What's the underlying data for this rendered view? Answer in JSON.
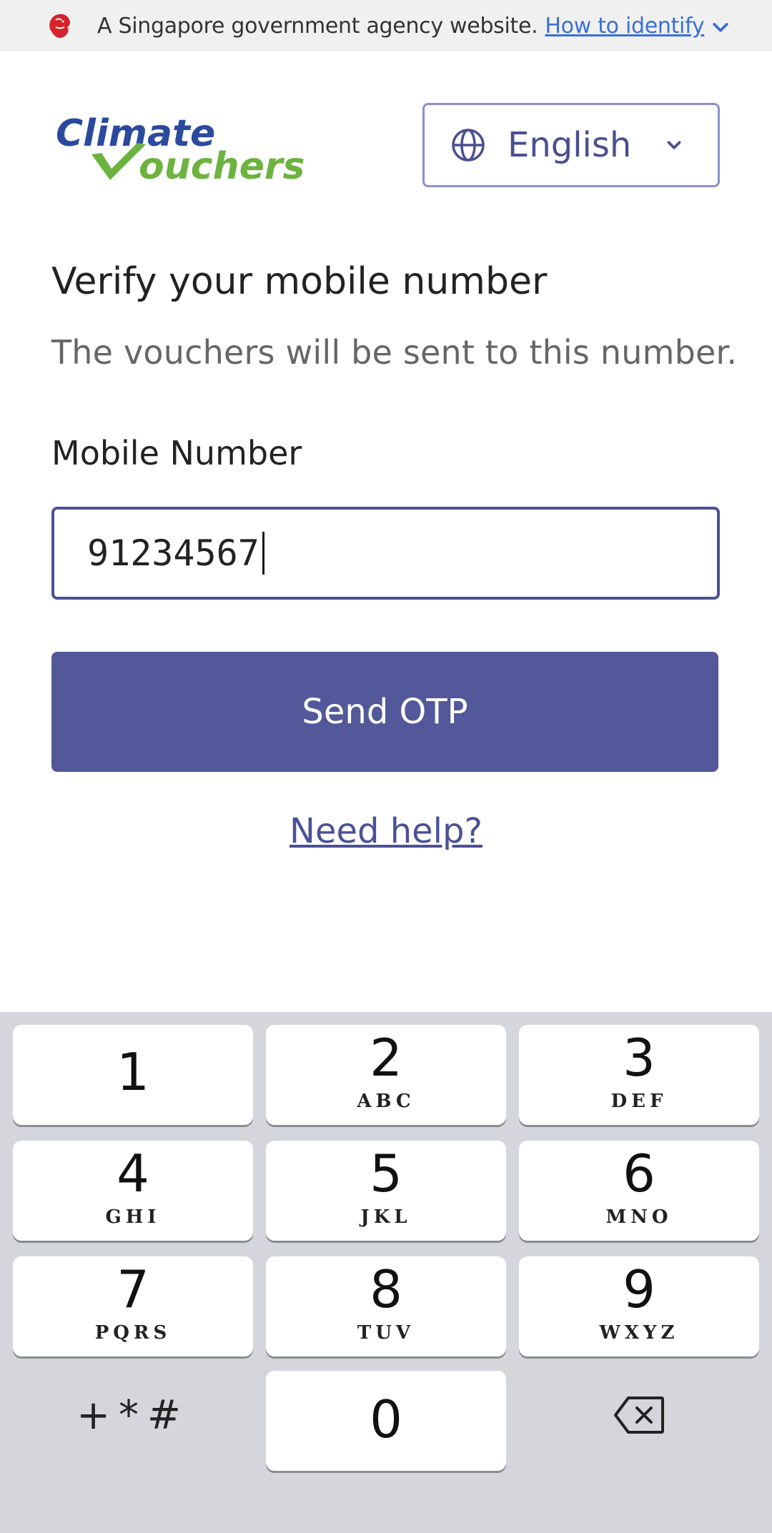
{
  "gov_banner": {
    "text": "A Singapore government agency website.",
    "link": "How to identify"
  },
  "header": {
    "logo_line1": "Climate",
    "logo_line2": "ouchers",
    "language": "English"
  },
  "main": {
    "title": "Verify your mobile number",
    "subtitle": "The vouchers will be sent to this number.",
    "mobile_label": "Mobile Number",
    "mobile_value": "91234567",
    "send_button": "Send OTP",
    "help_link": "Need help?"
  },
  "keypad": {
    "keys": [
      {
        "digit": "1",
        "letters": ""
      },
      {
        "digit": "2",
        "letters": "ABC"
      },
      {
        "digit": "3",
        "letters": "DEF"
      },
      {
        "digit": "4",
        "letters": "GHI"
      },
      {
        "digit": "5",
        "letters": "JKL"
      },
      {
        "digit": "6",
        "letters": "MNO"
      },
      {
        "digit": "7",
        "letters": "PQRS"
      },
      {
        "digit": "8",
        "letters": "TUV"
      },
      {
        "digit": "9",
        "letters": "WXYZ"
      },
      {
        "digit": "0",
        "letters": ""
      }
    ],
    "symbols": "+*#"
  },
  "colors": {
    "primary": "#525899",
    "link": "#3a6fd6",
    "logo_blue": "#2b4a9e",
    "logo_green": "#6cb33f",
    "keypad_bg": "#d4d6dc"
  }
}
